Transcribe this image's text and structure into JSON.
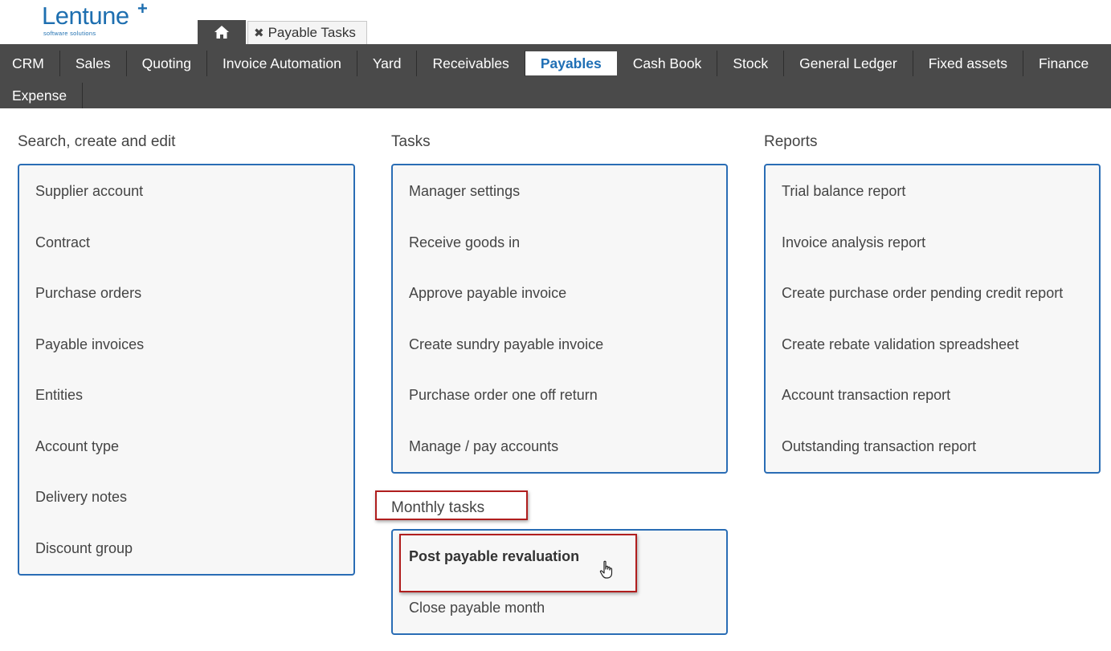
{
  "logo": {
    "name": "Lentune",
    "plus": "+",
    "tagline": "software solutions"
  },
  "tabs": {
    "home_icon": "home-icon",
    "open_tab": {
      "close_glyph": "✖",
      "label": "Payable Tasks"
    }
  },
  "nav": {
    "row1": [
      "CRM",
      "Sales",
      "Quoting",
      "Invoice Automation",
      "Yard",
      "Receivables",
      "Payables",
      "Cash Book",
      "Stock",
      "General Ledger",
      "Fixed assets",
      "Finance"
    ],
    "row2": [
      "Expense"
    ],
    "active": "Payables"
  },
  "sections": {
    "search": {
      "title": "Search, create and edit",
      "items": [
        "Supplier account",
        "Contract",
        "Purchase orders",
        "Payable invoices",
        "Entities",
        "Account type",
        "Delivery notes",
        "Discount group"
      ]
    },
    "tasks": {
      "title": "Tasks",
      "items": [
        "Manager settings",
        "Receive goods in",
        "Approve payable invoice",
        "Create sundry payable invoice",
        "Purchase order one off return",
        "Manage / pay accounts"
      ]
    },
    "reports": {
      "title": "Reports",
      "items": [
        "Trial balance report",
        "Invoice analysis report",
        "Create purchase order pending credit report",
        "Create rebate validation spreadsheet",
        "Account transaction report",
        "Outstanding transaction report"
      ]
    },
    "monthly": {
      "title": "Monthly tasks",
      "items": [
        "Post payable revaluation",
        "Close payable month"
      ]
    }
  },
  "colors": {
    "accent": "#2a6db5",
    "navbar": "#4a4a4a",
    "highlight": "#b01e1e"
  }
}
